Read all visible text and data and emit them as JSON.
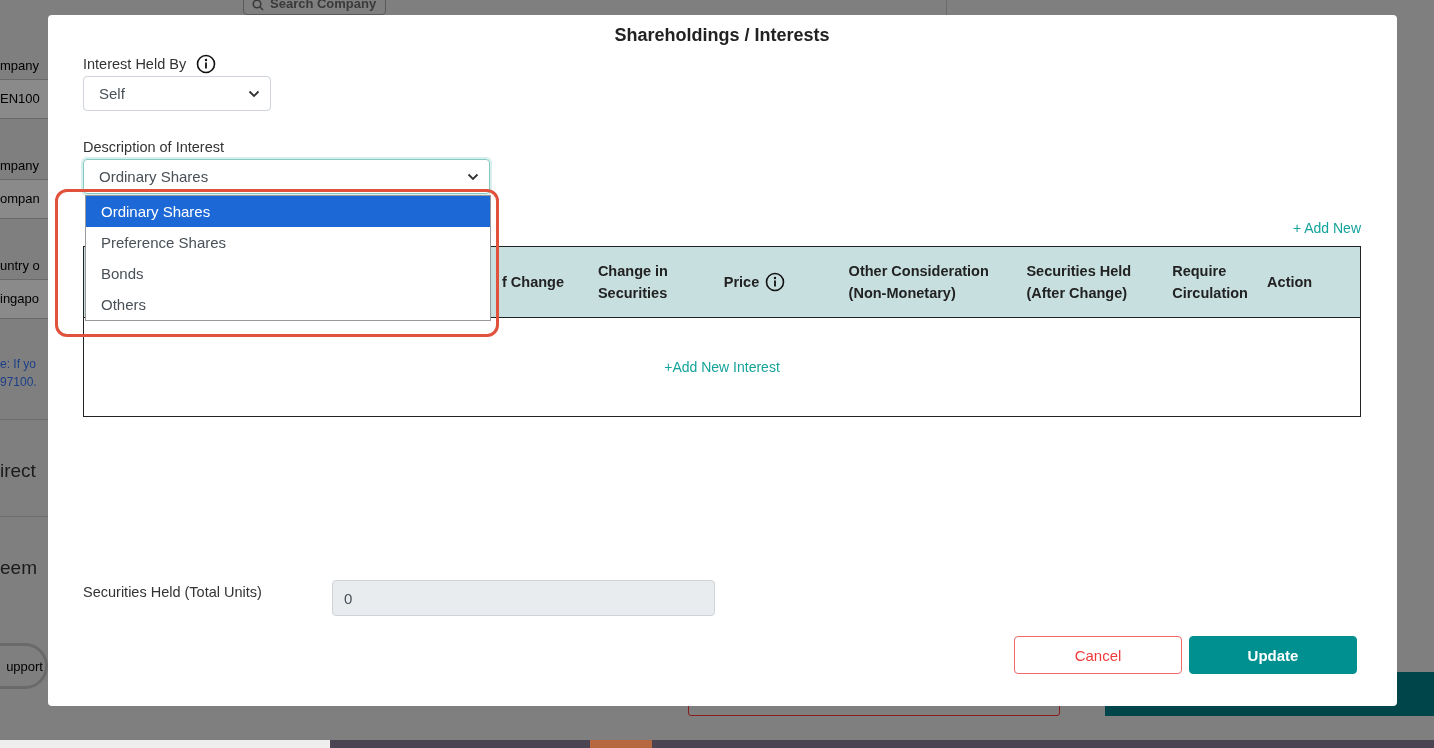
{
  "background": {
    "search_button": "Search Company",
    "fields": [
      {
        "label": "mpany",
        "value": "EN100"
      },
      {
        "label": "mpany",
        "value": "ompan"
      },
      {
        "label": "untry o",
        "value": "ingapo"
      }
    ],
    "note": [
      "e: If yo",
      "97100."
    ],
    "sections": [
      "irect",
      "eem"
    ],
    "support_button": "upport"
  },
  "modal": {
    "title": "Shareholdings / Interests",
    "interest_held_by": {
      "label": "Interest Held By",
      "value": "Self"
    },
    "description": {
      "label": "Description of Interest",
      "value": "Ordinary Shares",
      "expanded": true,
      "options": [
        {
          "label": "Ordinary Shares",
          "selected": true
        },
        {
          "label": "Preference Shares",
          "selected": false
        },
        {
          "label": "Bonds",
          "selected": false
        },
        {
          "label": "Others",
          "selected": false
        }
      ]
    },
    "add_new": "+ Add New",
    "table": {
      "columns": [
        {
          "label": "f Change",
          "info": false
        },
        {
          "label": "Change in Securities",
          "info": false
        },
        {
          "label": "Price",
          "info": true
        },
        {
          "label": "Other Consideration (Non-Monetary)",
          "info": false
        },
        {
          "label": "Securities Held (After Change)",
          "info": false
        },
        {
          "label": "Require Circulation",
          "info": false
        },
        {
          "label": "Action",
          "info": false
        }
      ],
      "add_row_link": "+Add New Interest"
    },
    "total": {
      "label": "Securities Held (Total Units)",
      "value": "0"
    },
    "buttons": [
      {
        "label": "Cancel",
        "kind": "secondary"
      },
      {
        "label": "Update",
        "kind": "primary"
      }
    ]
  }
}
